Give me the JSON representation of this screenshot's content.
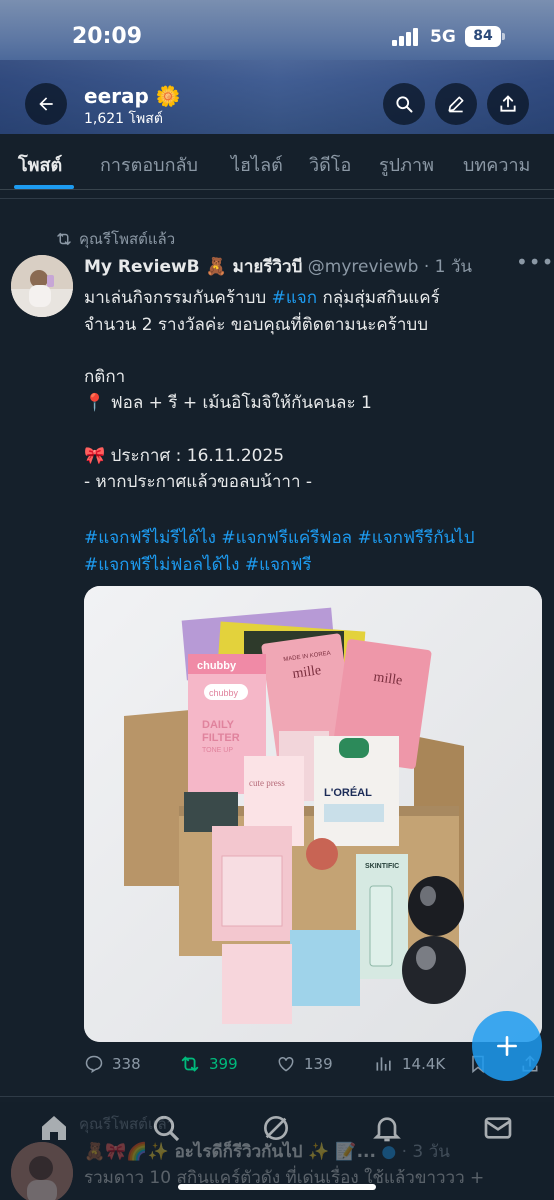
{
  "status_bar": {
    "time": "20:09",
    "network": "5G",
    "battery": "84"
  },
  "profile": {
    "name": "eerap 🌼",
    "post_count": "1,621 โพสต์"
  },
  "tabs": [
    {
      "label": "โพสต์",
      "active": true
    },
    {
      "label": "การตอบกลับ",
      "active": false
    },
    {
      "label": "ไฮไลต์",
      "active": false
    },
    {
      "label": "วิดีโอ",
      "active": false
    },
    {
      "label": "รูปภาพ",
      "active": false
    },
    {
      "label": "บทความ",
      "active": false
    }
  ],
  "post": {
    "repost_label": "คุณรีโพสต์แล้ว",
    "author_name": "My ReviewB 🧸 มายรีวิวบี",
    "handle": "@myreviewb",
    "time": "· 1 วัน",
    "line1_pre": "มาเล่นกิจกรรมกันคร้าบบ ",
    "line1_hash": "#แจก",
    "line1_post": " กลุ่มสุ่มสกินแคร์",
    "line2": "จำนวน 2 รางวัลค่ะ ขอบคุณที่ติดตามนะคร้าบบ",
    "line3": "กติกา",
    "line4": "📍 ฟอล + รี + เม้นอิโมจิให้กันคนละ 1",
    "line5": "🎀 ประกาศ : 16.11.2025",
    "line6": "- หากประกาศแล้วขอลบน้าาา -",
    "hashtags_line1": "#แจกฟรีไม่รีได้ไง #แจกฟรีแค่รีฟอล #แจกฟรีรีกันไป",
    "hashtags_line2": "#แจกฟรีไม่ฟอลได้ไง #แจกฟรี",
    "replies": "338",
    "reposts": "399",
    "likes": "139",
    "views": "14.4K"
  },
  "next_post": {
    "repost_label": "คุณรีโพสต์แล้ว",
    "author_name": "🧸🎀🌈✨ อะไรดีก็รีวิวกันไป ✨ 📝...",
    "time": "· 3 วัน",
    "line1": "รวมดาว 10 สกินแคร์ตัวดัง ที่เด่นเรื่อง ใช้แล้วขาววว +"
  },
  "product_text": {
    "chubby_top": "chubby",
    "chubby_small": "chubby",
    "daily": "DAILY",
    "filter": "FILTER",
    "tone_up": "TONE UP",
    "mille": "mille",
    "made_in_korea": "MADE IN KOREA",
    "cute_press": "cute press",
    "loreal": "L'ORÉAL",
    "skintific": "SKINTIFIC"
  },
  "colors": {
    "accent": "#1d9bf0",
    "repost_green": "#00ba7c",
    "background": "#15202b",
    "muted": "#8b98a5"
  }
}
